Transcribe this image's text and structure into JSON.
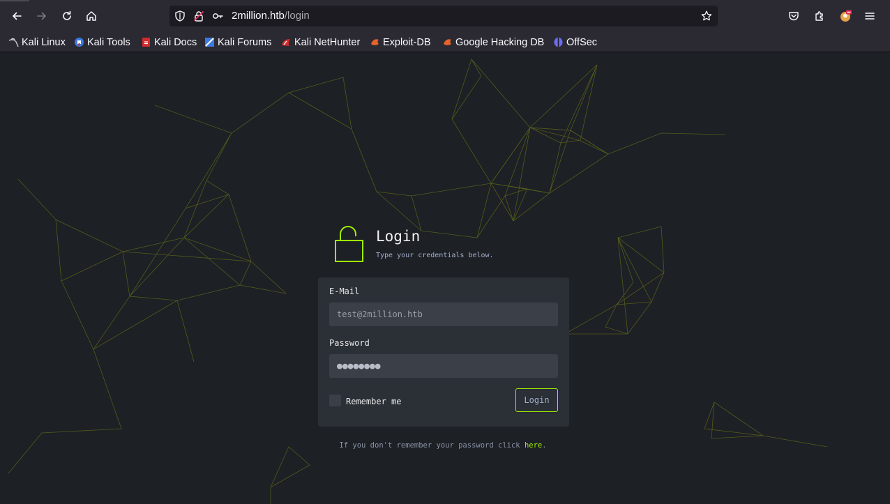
{
  "browser": {
    "url_host": "2million.htb",
    "url_path": "/login",
    "icons": [
      "back-arrow-icon",
      "forward-arrow-icon",
      "reload-icon",
      "home-icon",
      "shield-icon",
      "lock-icon",
      "key-icon",
      "bookmark-star-icon",
      "pocket-icon",
      "extensions-icon",
      "profile-icon",
      "menu-icon"
    ],
    "bookmarks": [
      {
        "label": "Kali Linux",
        "color": "#cccccc"
      },
      {
        "label": "Kali Tools",
        "color": "#3b7be0"
      },
      {
        "label": "Kali Docs",
        "color": "#d22b2b"
      },
      {
        "label": "Kali Forums",
        "color": "#3b7be0"
      },
      {
        "label": "Kali NetHunter",
        "color": "#d22b2b"
      },
      {
        "label": "Exploit-DB",
        "color": "#e8632a"
      },
      {
        "label": "Google Hacking DB",
        "color": "#e8632a"
      },
      {
        "label": "OffSec",
        "color": "#6c6cf0"
      }
    ]
  },
  "login": {
    "title": "Login",
    "subtitle": "Type your credentials below.",
    "email_label": "E-Mail",
    "email_placeholder": "test@2million.htb",
    "password_label": "Password",
    "password_value": "●●●●●●●●",
    "remember_label": "Remember me",
    "submit_label": "Login",
    "forgot_text": "If you don't remember your password click ",
    "forgot_link": "here",
    "forgot_end": ".",
    "accent_color": "#9fef00"
  }
}
